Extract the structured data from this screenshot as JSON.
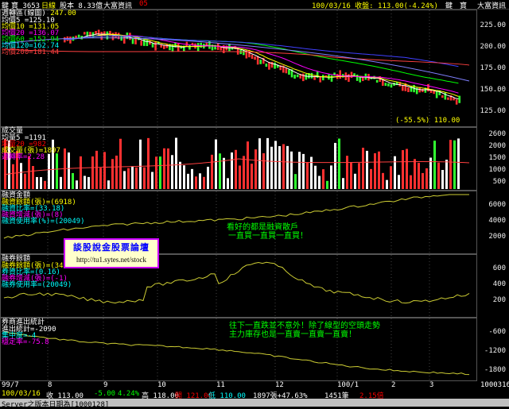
{
  "top_bar": {
    "left_a": "鍵",
    "left_b": "寶 3653",
    "period": "日線",
    "stock_label": "股本 8.33億",
    "source": "大富資訊",
    "code": "05",
    "date_info": "100/03/16 收盤: 113.00(-4.24%)",
    "right_a": "鍵",
    "right_b": "寶",
    "right_source": "大富資訊"
  },
  "price_panel": {
    "title": "週轉區(線圖)",
    "title_value": "247.00",
    "ma_labels": [
      {
        "text": "均價5 =125.10",
        "color": "#ffffff"
      },
      {
        "text": "均價10 =131.05",
        "color": "#ffff00"
      },
      {
        "text": "均價20 =136.07",
        "color": "#ff00ff"
      },
      {
        "text": "均價60 =152.94",
        "color": "#00ff00"
      },
      {
        "text": "均價120=162.74",
        "color": "#00ffff"
      },
      {
        "text": "均價200=181.44",
        "color": "#ff4040"
      }
    ],
    "axis_ticks": [
      "225.00",
      "200.00",
      "175.00",
      "150.00",
      "125.00"
    ],
    "low_note": "(-55.5%) 110.00"
  },
  "volume_panel": {
    "title": "成交量",
    "labels": [
      {
        "text": "均量5 =1191",
        "color": "#ffffff"
      },
      {
        "text": "均量20 =982",
        "color": "#ff0000"
      },
      {
        "text": "成交量(張)=1897",
        "color": "#ffff00"
      },
      {
        "text": "週轉率=2.28",
        "color": "#ff00ff"
      }
    ],
    "axis_ticks": [
      "2600",
      "2000",
      "1500",
      "1000",
      "500"
    ]
  },
  "margin_panel": {
    "title": "融資金額",
    "labels": [
      {
        "text": "融資餘額(張)=(6918)",
        "color": "#ffff00"
      },
      {
        "text": "融資比率=(33.18)",
        "color": "#00ffff"
      },
      {
        "text": "融資增減(張)=(8)",
        "color": "#ff00ff"
      },
      {
        "text": "融資使用率(%)=(20049)",
        "color": "#00ffff"
      }
    ],
    "axis_ticks": [
      "6000",
      "4000",
      "2000"
    ],
    "note_1": "看好的都是融資散戶",
    "note_2": "一直買一直買一直買！"
  },
  "short_panel": {
    "title": "融券餘額",
    "labels": [
      {
        "text": "融券餘額(張)=(34)",
        "color": "#ffff00"
      },
      {
        "text": "券資比率=(0.16)",
        "color": "#00ffff"
      },
      {
        "text": "融券增減(張)=(-1)",
        "color": "#ff00ff"
      },
      {
        "text": "融券使用率=(20049)",
        "color": "#00ffff"
      }
    ],
    "axis_ticks": [
      "600",
      "400",
      "200"
    ]
  },
  "inst_panel": {
    "title": "券商進出統計",
    "labels": [
      {
        "text": "進出統計=-2090",
        "color": "#ffffff"
      },
      {
        "text": "集中度=-4",
        "color": "#00ffff"
      },
      {
        "text": "穩定率=-75.8",
        "color": "#ff00ff"
      }
    ],
    "axis_ticks": [
      "-600",
      "-1200",
      "-1800"
    ],
    "note_1": "往下一直跌並不意外！除了線型的空頭走勢",
    "note_2": "主力庫存也是一直賣一直賣一直賣！"
  },
  "x_axis": [
    "99/7",
    "8",
    "9",
    "10",
    "11",
    "12",
    "100/1",
    "2",
    "3"
  ],
  "x_axis_right": "1000316",
  "status": {
    "date": "100/03/16",
    "close": "收 113.00",
    "change": "-5.00",
    "pct": "4.24%",
    "high": "高 118.00",
    "open": "開 121.00",
    "low": "低 110.00",
    "vol": "1897張+47.63%",
    "lot": "1451筆",
    "turn": "2.15倍"
  },
  "watermark": {
    "title": "談股說金股票論壇",
    "url": "http://tu1.sytes.net/stock"
  },
  "server_text": "Server之版本日期為[1000128]"
}
